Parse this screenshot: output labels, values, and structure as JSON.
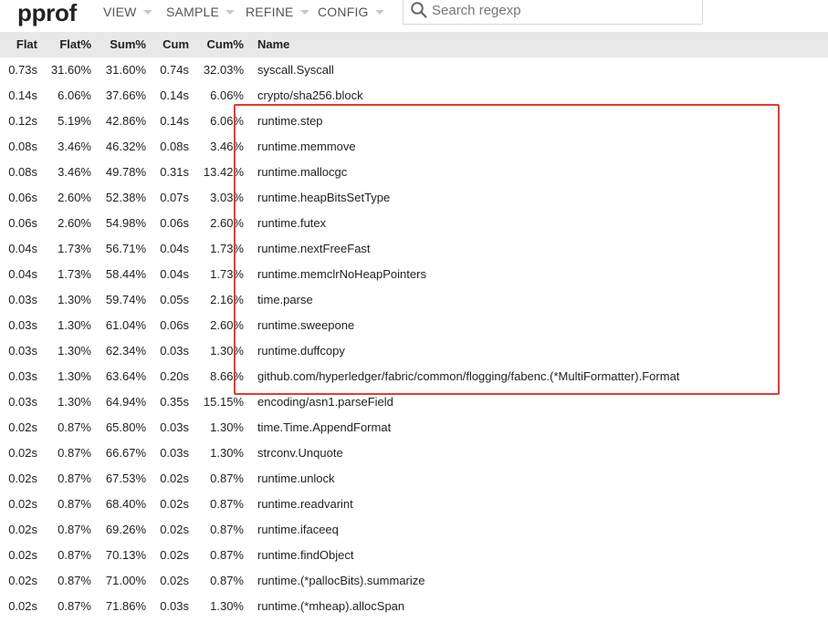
{
  "app": {
    "logo": "pprof"
  },
  "menu": [
    {
      "label": "VIEW"
    },
    {
      "label": "SAMPLE"
    },
    {
      "label": "REFINE"
    },
    {
      "label": "CONFIG"
    }
  ],
  "search": {
    "placeholder": "Search regexp",
    "value": ""
  },
  "table": {
    "headers": {
      "flat": "Flat",
      "flat_pct": "Flat%",
      "sum_pct": "Sum%",
      "cum": "Cum",
      "cum_pct": "Cum%",
      "name": "Name"
    },
    "rows": [
      {
        "flat": "0.73s",
        "flat_pct": "31.60%",
        "sum_pct": "31.60%",
        "cum": "0.74s",
        "cum_pct": "32.03%",
        "name": "syscall.Syscall"
      },
      {
        "flat": "0.14s",
        "flat_pct": "6.06%",
        "sum_pct": "37.66%",
        "cum": "0.14s",
        "cum_pct": "6.06%",
        "name": "crypto/sha256.block"
      },
      {
        "flat": "0.12s",
        "flat_pct": "5.19%",
        "sum_pct": "42.86%",
        "cum": "0.14s",
        "cum_pct": "6.06%",
        "name": "runtime.step"
      },
      {
        "flat": "0.08s",
        "flat_pct": "3.46%",
        "sum_pct": "46.32%",
        "cum": "0.08s",
        "cum_pct": "3.46%",
        "name": "runtime.memmove"
      },
      {
        "flat": "0.08s",
        "flat_pct": "3.46%",
        "sum_pct": "49.78%",
        "cum": "0.31s",
        "cum_pct": "13.42%",
        "name": "runtime.mallocgc"
      },
      {
        "flat": "0.06s",
        "flat_pct": "2.60%",
        "sum_pct": "52.38%",
        "cum": "0.07s",
        "cum_pct": "3.03%",
        "name": "runtime.heapBitsSetType"
      },
      {
        "flat": "0.06s",
        "flat_pct": "2.60%",
        "sum_pct": "54.98%",
        "cum": "0.06s",
        "cum_pct": "2.60%",
        "name": "runtime.futex"
      },
      {
        "flat": "0.04s",
        "flat_pct": "1.73%",
        "sum_pct": "56.71%",
        "cum": "0.04s",
        "cum_pct": "1.73%",
        "name": "runtime.nextFreeFast"
      },
      {
        "flat": "0.04s",
        "flat_pct": "1.73%",
        "sum_pct": "58.44%",
        "cum": "0.04s",
        "cum_pct": "1.73%",
        "name": "runtime.memclrNoHeapPointers"
      },
      {
        "flat": "0.03s",
        "flat_pct": "1.30%",
        "sum_pct": "59.74%",
        "cum": "0.05s",
        "cum_pct": "2.16%",
        "name": "time.parse"
      },
      {
        "flat": "0.03s",
        "flat_pct": "1.30%",
        "sum_pct": "61.04%",
        "cum": "0.06s",
        "cum_pct": "2.60%",
        "name": "runtime.sweepone"
      },
      {
        "flat": "0.03s",
        "flat_pct": "1.30%",
        "sum_pct": "62.34%",
        "cum": "0.03s",
        "cum_pct": "1.30%",
        "name": "runtime.duffcopy"
      },
      {
        "flat": "0.03s",
        "flat_pct": "1.30%",
        "sum_pct": "63.64%",
        "cum": "0.20s",
        "cum_pct": "8.66%",
        "name": "github.com/hyperledger/fabric/common/flogging/fabenc.(*MultiFormatter).Format"
      },
      {
        "flat": "0.03s",
        "flat_pct": "1.30%",
        "sum_pct": "64.94%",
        "cum": "0.35s",
        "cum_pct": "15.15%",
        "name": "encoding/asn1.parseField"
      },
      {
        "flat": "0.02s",
        "flat_pct": "0.87%",
        "sum_pct": "65.80%",
        "cum": "0.03s",
        "cum_pct": "1.30%",
        "name": "time.Time.AppendFormat"
      },
      {
        "flat": "0.02s",
        "flat_pct": "0.87%",
        "sum_pct": "66.67%",
        "cum": "0.03s",
        "cum_pct": "1.30%",
        "name": "strconv.Unquote"
      },
      {
        "flat": "0.02s",
        "flat_pct": "0.87%",
        "sum_pct": "67.53%",
        "cum": "0.02s",
        "cum_pct": "0.87%",
        "name": "runtime.unlock"
      },
      {
        "flat": "0.02s",
        "flat_pct": "0.87%",
        "sum_pct": "68.40%",
        "cum": "0.02s",
        "cum_pct": "0.87%",
        "name": "runtime.readvarint"
      },
      {
        "flat": "0.02s",
        "flat_pct": "0.87%",
        "sum_pct": "69.26%",
        "cum": "0.02s",
        "cum_pct": "0.87%",
        "name": "runtime.ifaceeq"
      },
      {
        "flat": "0.02s",
        "flat_pct": "0.87%",
        "sum_pct": "70.13%",
        "cum": "0.02s",
        "cum_pct": "0.87%",
        "name": "runtime.findObject"
      },
      {
        "flat": "0.02s",
        "flat_pct": "0.87%",
        "sum_pct": "71.00%",
        "cum": "0.02s",
        "cum_pct": "0.87%",
        "name": "runtime.(*pallocBits).summarize"
      },
      {
        "flat": "0.02s",
        "flat_pct": "0.87%",
        "sum_pct": "71.86%",
        "cum": "0.03s",
        "cum_pct": "1.30%",
        "name": "runtime.(*mheap).allocSpan"
      }
    ]
  },
  "annotation": {
    "color": "#e33b33"
  }
}
